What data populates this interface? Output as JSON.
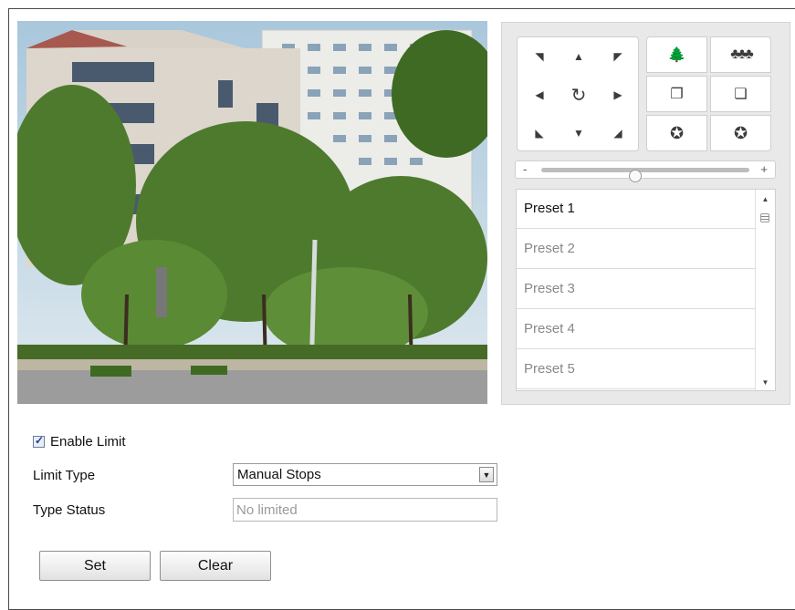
{
  "ptz": {
    "direction_pad": [
      "▼",
      "▲",
      "◀",
      "◀",
      "↻",
      "▶",
      "▶",
      "▼",
      "◀"
    ],
    "zoom_labels": {
      "zoom_in": "tree-small",
      "zoom_out": "trees-wide"
    },
    "speed_minus": "-",
    "speed_plus": "+",
    "speed_level": 0.45,
    "presets": [
      "Preset 1",
      "Preset 2",
      "Preset 3",
      "Preset 4",
      "Preset 5"
    ]
  },
  "form": {
    "enable_limit_label": "Enable Limit",
    "limit_type_label": "Limit Type",
    "limit_type_value": "Manual Stops",
    "type_status_label": "Type Status",
    "type_status_placeholder": "No limited",
    "set_label": "Set",
    "clear_label": "Clear"
  }
}
